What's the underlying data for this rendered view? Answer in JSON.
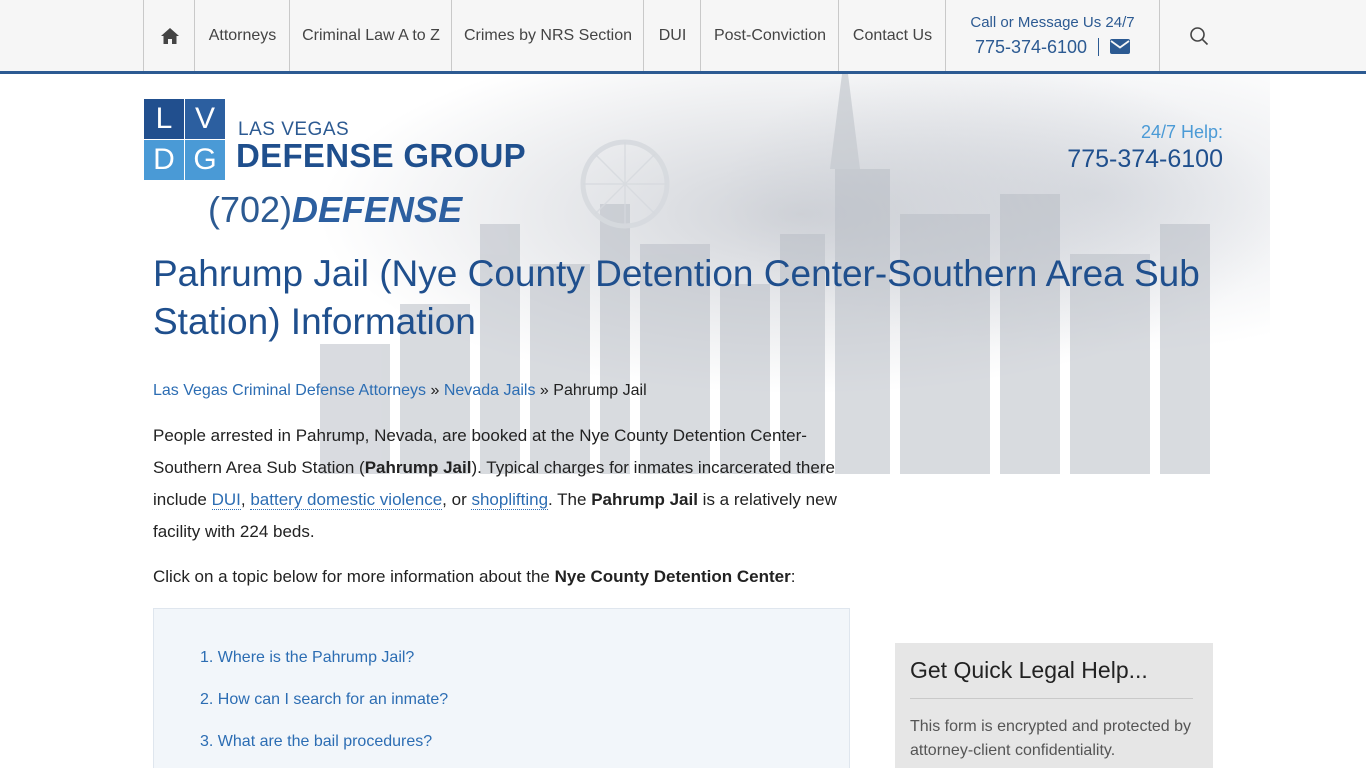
{
  "nav": {
    "items": [
      "Attorneys",
      "Criminal Law A to Z",
      "Crimes by NRS Section",
      "DUI",
      "Post-Conviction",
      "Contact Us"
    ],
    "call_label": "Call or Message Us 24/7",
    "call_phone": "775-374-6100",
    "home_icon": "home-icon",
    "mail_icon": "envelope-icon",
    "search_icon": "search-icon"
  },
  "logo": {
    "letters": [
      "L",
      "V",
      "D",
      "G"
    ],
    "top_text": "LAS VEGAS",
    "main_text": "DEFENSE GROUP",
    "phone_prefix": "(702)",
    "phone_word": "DEFENSE"
  },
  "help": {
    "label": "24/7 Help:",
    "phone": "775-374-6100"
  },
  "page": {
    "title": "Pahrump Jail (Nye County Detention Center-Southern Area Sub Station) Information",
    "breadcrumb": {
      "crumb1": "Las Vegas Criminal Defense Attorneys",
      "sep": "»",
      "crumb2": "Nevada Jails",
      "current": "Pahrump Jail"
    },
    "intro": {
      "t1": "People arrested in Pahrump, Nevada, are booked at the Nye County Detention Center-Southern Area Sub Station (",
      "b1": "Pahrump Jail",
      "t2": "). Typical charges for inmates incarcerated there include ",
      "link1": "DUI",
      "t3": ", ",
      "link2": "battery domestic violence",
      "t4": ", or ",
      "link3": "shoplifting",
      "t5": ". The ",
      "b2": "Pahrump Jail",
      "t6": " is a relatively new facility with 224 beds."
    },
    "click": {
      "t1": "Click on a topic below for more information about the ",
      "b1": "Nye County Detention Center",
      "t2": ":"
    },
    "toc": [
      "1. Where is the Pahrump Jail?",
      "2. How can I search for an inmate?",
      "3. What are the bail procedures?"
    ]
  },
  "sidebar": {
    "title": "Get Quick Legal Help...",
    "text": "This form is encrypted and protected by attorney-client confidentiality."
  },
  "colors": {
    "brand_dark": "#1f4f8d",
    "brand": "#2c5a92",
    "brand_light": "#4a9ad6",
    "link": "#2c6db3"
  }
}
